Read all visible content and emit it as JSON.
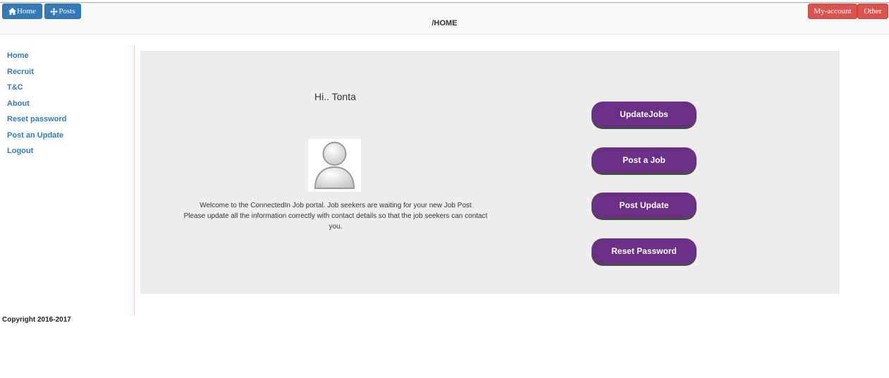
{
  "navbar": {
    "home_label": "Home",
    "posts_label": "Posts",
    "account_label": "My-account",
    "other_label": "Other",
    "page_path": "/HOME"
  },
  "sidebar": {
    "items": [
      {
        "label": "Home"
      },
      {
        "label": "Recruit"
      },
      {
        "label": "T&C"
      },
      {
        "label": "About"
      },
      {
        "label": "Reset password"
      },
      {
        "label": "Post an Update"
      },
      {
        "label": "Logout"
      }
    ]
  },
  "main": {
    "greeting": "Hi.. Tonta",
    "welcome_line1": "Welcome to the ConnectedIn Job portal. Job seekers are waiting for your new Job Post",
    "welcome_line2": "Please update all the information correctly with contact details so that the job seekers can contact you.",
    "buttons": [
      {
        "label": "UpdateJobs"
      },
      {
        "label": "Post a Job"
      },
      {
        "label": "Post Update"
      },
      {
        "label": "Reset Password"
      }
    ]
  },
  "footer": {
    "copyright": "Copyright 2016-2017"
  },
  "colors": {
    "primary": "#337ab7",
    "danger": "#d9534f",
    "accent_button": "#6a3085",
    "panel_bg": "#eeeeee"
  },
  "icons": {
    "home": "home-icon",
    "posts": "move-icon",
    "avatar": "user-silhouette-icon"
  }
}
